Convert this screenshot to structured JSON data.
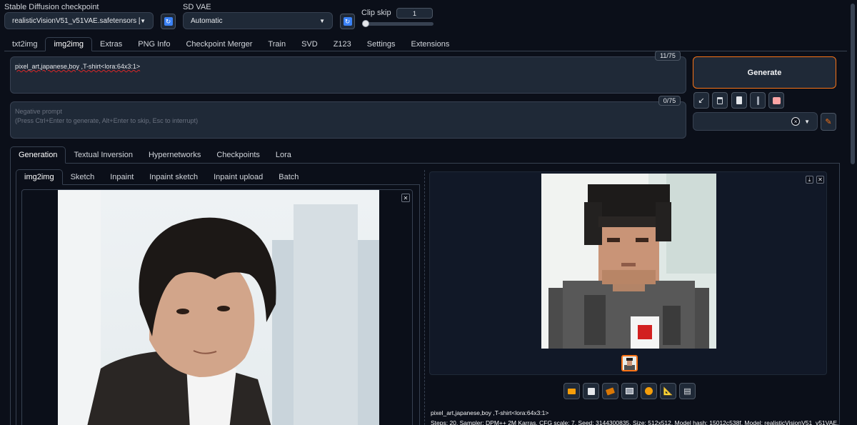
{
  "header": {
    "checkpoint_label": "Stable Diffusion checkpoint",
    "checkpoint_value": "realisticVisionV51_v51VAE.safetensors [15012c5",
    "vae_label": "SD VAE",
    "vae_value": "Automatic",
    "clip_skip_label": "Clip skip",
    "clip_skip_value": "1",
    "clip_skip_level": 0
  },
  "main_tabs": [
    "txt2img",
    "img2img",
    "Extras",
    "PNG Info",
    "Checkpoint Merger",
    "Train",
    "SVD",
    "Z123",
    "Settings",
    "Extensions"
  ],
  "prompt": {
    "text": "pixel_art,japanese,boy ,T-shirt<lora:64x3:1>",
    "counter": "11/75"
  },
  "negative_prompt": {
    "placeholder_line1": "Negative prompt",
    "placeholder_line2": "(Press Ctrl+Enter to generate, Alt+Enter to skip, Esc to interrupt)",
    "counter": "0/75"
  },
  "generate_label": "Generate",
  "style_close": "×",
  "sub_tabs": [
    "Generation",
    "Textual Inversion",
    "Hypernetworks",
    "Checkpoints",
    "Lora"
  ],
  "mode_tabs": [
    "img2img",
    "Sketch",
    "Inpaint",
    "Inpaint sketch",
    "Inpaint upload",
    "Batch"
  ],
  "output": {
    "info_line1": "pixel_art,japanese,boy ,T-shirt<lora:64x3:1>",
    "info_line2": "Steps: 20, Sampler: DPM++ 2M Karras, CFG scale: 7, Seed: 3144300835, Size: 512x512, Model hash: 15012c538f, Model: realisticVisionV51_v51VAE,"
  },
  "colors": {
    "background": "#0b0f19",
    "accent_orange": "#f97316",
    "refresh_blue": "#3b82f6"
  }
}
